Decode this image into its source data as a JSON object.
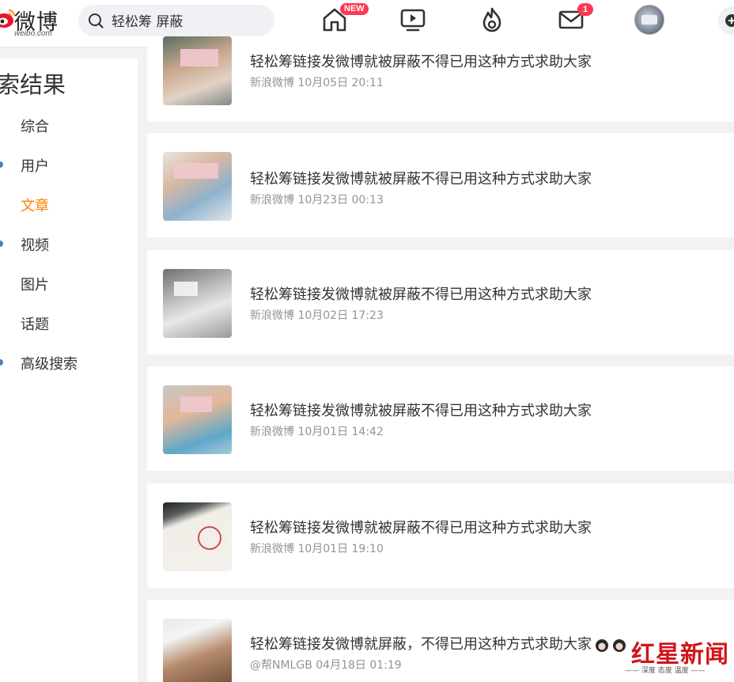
{
  "header": {
    "logo_text": "微博",
    "logo_sub": "weibo.com",
    "search_value": "轻松筹 屏蔽",
    "badge_new": "NEW",
    "mail_count": "1"
  },
  "sidebar": {
    "title": "索结果",
    "items": [
      {
        "label": "综合"
      },
      {
        "label": "用户"
      },
      {
        "label": "文章"
      },
      {
        "label": "视频"
      },
      {
        "label": "图片"
      },
      {
        "label": "话题"
      },
      {
        "label": "高级搜索"
      }
    ]
  },
  "results": [
    {
      "title": "轻松筹链接发微博就被屏蔽不得已用这种方式求助大家",
      "meta": "新浪微博 10月05日 20:11"
    },
    {
      "title": "轻松筹链接发微博就被屏蔽不得已用这种方式求助大家",
      "meta": "新浪微博 10月23日 00:13"
    },
    {
      "title": "轻松筹链接发微博就被屏蔽不得已用这种方式求助大家",
      "meta": "新浪微博 10月02日 17:23"
    },
    {
      "title": "轻松筹链接发微博就被屏蔽不得已用这种方式求助大家",
      "meta": "新浪微博 10月01日 14:42"
    },
    {
      "title": "轻松筹链接发微博就被屏蔽不得已用这种方式求助大家",
      "meta": "新浪微博 10月01日 19:10"
    },
    {
      "title": "轻松筹链接发微博就屏蔽，不得已用这种方式求助大家",
      "meta": "@帮NMLGB 04月18日 01:19"
    }
  ],
  "watermark": {
    "main": "红星新闻",
    "sub": "—— 深度 态度 温度 ——"
  },
  "colors": {
    "accent": "#ff8200",
    "badge": "#ff3852",
    "watermark": "#d0151a"
  }
}
